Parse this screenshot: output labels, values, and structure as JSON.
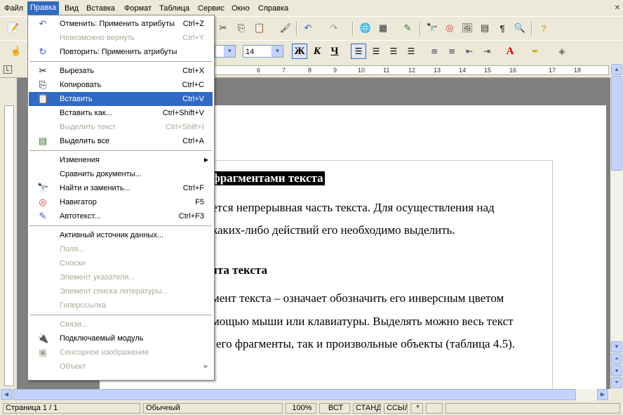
{
  "menubar": [
    "Файл",
    "Правка",
    "Вид",
    "Вставка",
    "Формат",
    "Таблица",
    "Сервис",
    "Окно",
    "Справка"
  ],
  "format_bar": {
    "font_size": "14",
    "bold": "Ж",
    "italic": "К",
    "underline": "Ч"
  },
  "ruler_marks": [
    "6",
    "7",
    "8",
    "9",
    "10",
    "11",
    "12",
    "13",
    "14",
    "15",
    "16",
    "17",
    "18"
  ],
  "edit_menu": [
    {
      "label": "Отменить: Применить атрибуты",
      "shortcut": "Ctrl+Z",
      "icon": "undo-icon",
      "disabled": false
    },
    {
      "label": "Невозможно вернуть",
      "shortcut": "Ctrl+Y",
      "icon": "",
      "disabled": true
    },
    {
      "label": "Повторить: Применить атрибуты",
      "shortcut": "",
      "icon": "repeat-icon",
      "disabled": false
    },
    {
      "sep": true
    },
    {
      "label": "Вырезать",
      "shortcut": "Ctrl+X",
      "icon": "cut-icon",
      "disabled": false
    },
    {
      "label": "Копировать",
      "shortcut": "Ctrl+C",
      "icon": "copy-icon",
      "disabled": false
    },
    {
      "label": "Вставить",
      "shortcut": "Ctrl+V",
      "icon": "paste-icon",
      "disabled": false,
      "selected": true
    },
    {
      "label": "Вставить как...",
      "shortcut": "Ctrl+Shift+V",
      "icon": "",
      "disabled": false
    },
    {
      "label": "Выделить текст",
      "shortcut": "Ctrl+Shift+I",
      "icon": "",
      "disabled": true
    },
    {
      "label": "Выделить все",
      "shortcut": "Ctrl+A",
      "icon": "select-all-icon",
      "disabled": false
    },
    {
      "sep": true
    },
    {
      "label": "Изменения",
      "shortcut": "",
      "icon": "",
      "disabled": false,
      "submenu": true
    },
    {
      "label": "Сравнить документы...",
      "shortcut": "",
      "icon": "",
      "disabled": false
    },
    {
      "label": "Найти и заменить...",
      "shortcut": "Ctrl+F",
      "icon": "binoculars-icon",
      "disabled": false
    },
    {
      "label": "Навигатор",
      "shortcut": "F5",
      "icon": "navigator-icon",
      "disabled": false
    },
    {
      "label": "Автотекст...",
      "shortcut": "Ctrl+F3",
      "icon": "autotext-icon",
      "disabled": false
    },
    {
      "sep": true
    },
    {
      "label": "Активный источник данных...",
      "shortcut": "",
      "icon": "",
      "disabled": false
    },
    {
      "label": "Поля...",
      "shortcut": "",
      "icon": "",
      "disabled": true
    },
    {
      "label": "Сноски",
      "shortcut": "",
      "icon": "",
      "disabled": true
    },
    {
      "label": "Элемент указателя...",
      "shortcut": "",
      "icon": "",
      "disabled": true
    },
    {
      "label": "Элемент списка литературы...",
      "shortcut": "",
      "icon": "",
      "disabled": true
    },
    {
      "label": "Гиперссылка",
      "shortcut": "",
      "icon": "",
      "disabled": true
    },
    {
      "sep": true
    },
    {
      "label": "Связи...",
      "shortcut": "",
      "icon": "",
      "disabled": true
    },
    {
      "label": "Подключаемый модуль",
      "shortcut": "",
      "icon": "plugin-icon",
      "disabled": false
    },
    {
      "label": "Сенсорное изображение",
      "shortcut": "",
      "icon": "imagemap-icon",
      "disabled": true
    },
    {
      "label": "Объект",
      "shortcut": "",
      "icon": "",
      "disabled": true,
      "submenu": true
    }
  ],
  "document": {
    "heading1": "фрагментами текста",
    "para1_line1": "ется непрерывная часть текста.  Для осуществления над",
    "para1_line2": "каких-либо действий его необходимо выделить.",
    "heading2": "нта текста",
    "para2_line1": "мент  текста  –  означает  обозначить  его  инверсным  цветом",
    "para2_line2": "мощью мыши или клавиатуры. Выделять можно весь текст",
    "para2_line3": "его фрагменты, так и произвольные объекты (таблица 4.5)."
  },
  "status": {
    "page": "Страница  1 / 1",
    "style": "Обычный",
    "zoom": "100%",
    "insert_mode": "ВСТ",
    "sel_mode": "СТАНД",
    "hyperlink_mode": "ССЫЛ",
    "modified": "*"
  },
  "colors": {
    "selection": "#316ac5",
    "menu_bg": "#ffffff",
    "chrome": "#ece9d8"
  }
}
